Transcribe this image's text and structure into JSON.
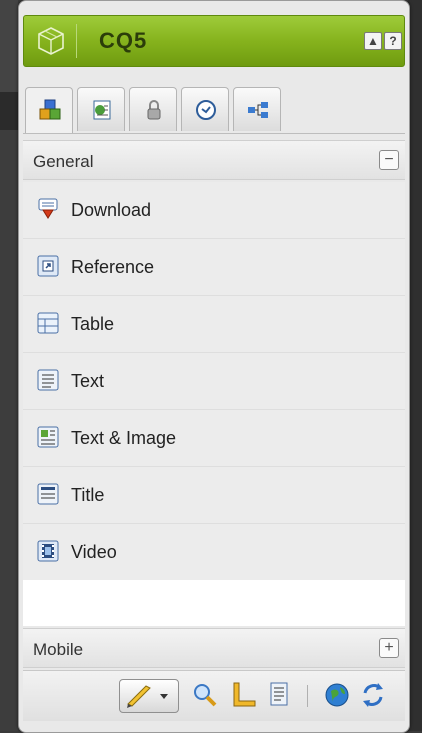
{
  "sidekick": {
    "brand": "CQ5",
    "header_buttons": [
      "▲",
      "?"
    ],
    "tabs": [
      {
        "icon": "components-icon",
        "active": true
      },
      {
        "icon": "page-icon",
        "active": false
      },
      {
        "icon": "lock-icon",
        "active": false
      },
      {
        "icon": "clock-icon",
        "active": false
      },
      {
        "icon": "workflow-icon",
        "active": false
      }
    ],
    "groups": {
      "general": {
        "label": "General",
        "toggle": "−",
        "expanded": true
      },
      "mobile": {
        "label": "Mobile",
        "toggle": "+",
        "expanded": false
      }
    },
    "components": [
      {
        "label": "Download",
        "icon": "download-icon"
      },
      {
        "label": "Reference",
        "icon": "reference-icon"
      },
      {
        "label": "Table",
        "icon": "table-icon"
      },
      {
        "label": "Text",
        "icon": "text-icon"
      },
      {
        "label": "Text & Image",
        "icon": "text-image-icon"
      },
      {
        "label": "Title",
        "icon": "title-icon"
      },
      {
        "label": "Video",
        "icon": "video-icon"
      }
    ],
    "toolbar": [
      "edit-pencil-icon",
      "search-icon",
      "design-ruler-icon",
      "preview-page-icon",
      "globe-icon",
      "refresh-icon"
    ],
    "colors": {
      "header_green": "#86b31d",
      "accent_blue": "#3b78c4"
    }
  }
}
